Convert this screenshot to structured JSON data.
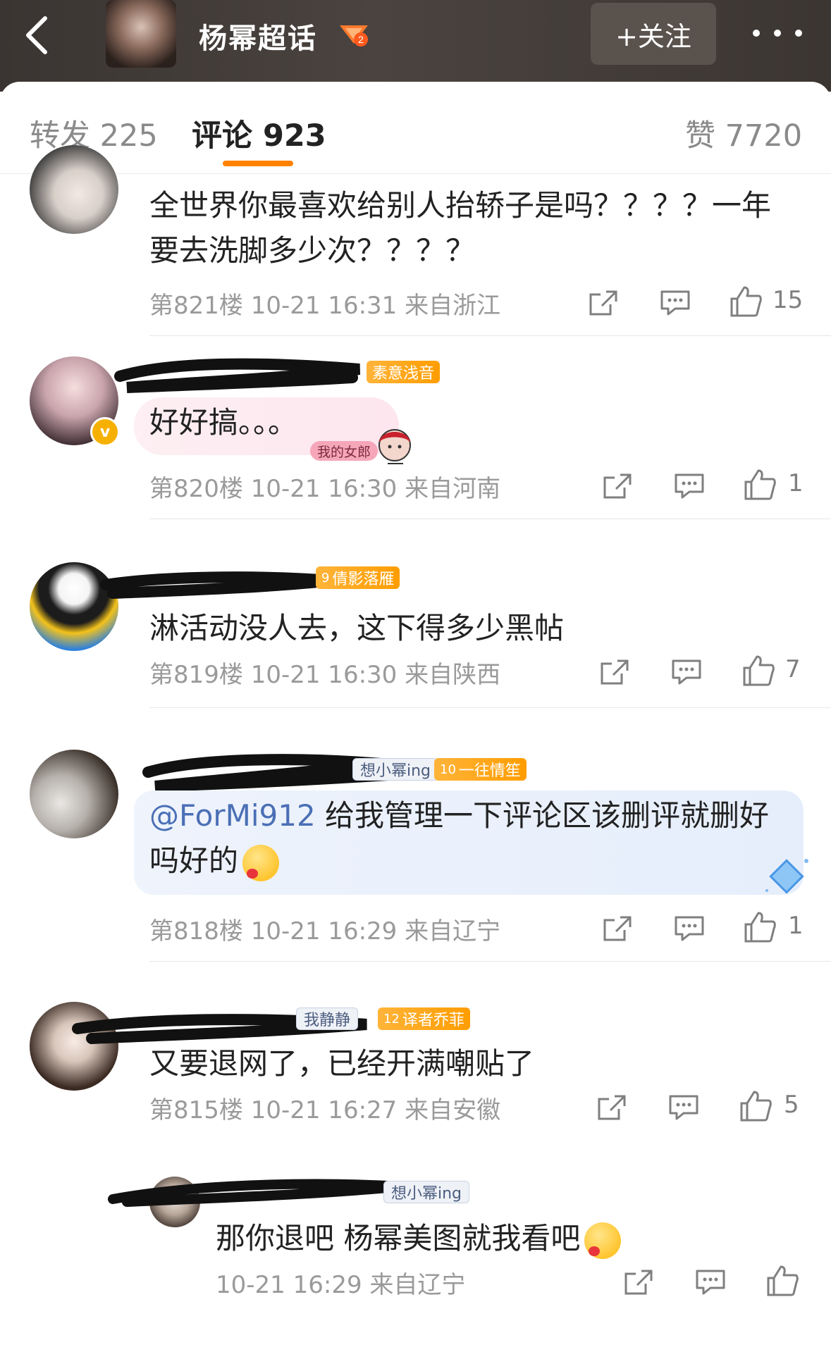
{
  "header": {
    "title": "杨幂超话",
    "badge_level": "2",
    "follow_label": "+关注"
  },
  "tabs": [
    {
      "label": "转发 225"
    },
    {
      "label": "评论 923"
    },
    {
      "label": "赞 7720"
    }
  ],
  "comments": [
    {
      "text": "全世界你最喜欢给别人抬轿子是吗？？？？一年要去洗脚多少次？？？？",
      "meta": "第821楼 10-21 16:31 来自浙江",
      "likes": "15"
    },
    {
      "fan_badge": "素意浅音",
      "text": "好好搞。。。",
      "sticker_label": "我的女郎",
      "meta": "第820楼 10-21 16:30 来自河南",
      "likes": "1"
    },
    {
      "fan_badge": "倩影落雁",
      "fan_level": "9",
      "text": "淋活动没人去，这下得多少黑帖",
      "meta": "第819楼 10-21 16:30 来自陕西",
      "likes": "7"
    },
    {
      "tag": "想小幂ing",
      "fan_badge": "一往情笙",
      "fan_level": "10",
      "mention": "@ForMi912",
      "text": " 给我管理一下评论区该删评就删好吗好的",
      "meta": "第818楼 10-21 16:29 来自辽宁",
      "likes": "1"
    },
    {
      "tag": "我静静",
      "fan_badge": "译者乔菲",
      "fan_level": "12",
      "text": "又要退网了，已经开满嘲贴了",
      "meta": "第815楼 10-21 16:27 来自安徽",
      "likes": "5"
    }
  ],
  "reply": {
    "tag": "想小幂ing",
    "text": "那你退吧 杨幂美图就我看吧",
    "meta": "10-21 16:29 来自辽宁"
  },
  "colors": {
    "accent": "#ff8200",
    "mention": "#4a6fb5",
    "fan_badge": "#ffa51f"
  },
  "icons": [
    "back-icon",
    "share-icon",
    "comment-icon",
    "like-icon",
    "more-icon"
  ]
}
